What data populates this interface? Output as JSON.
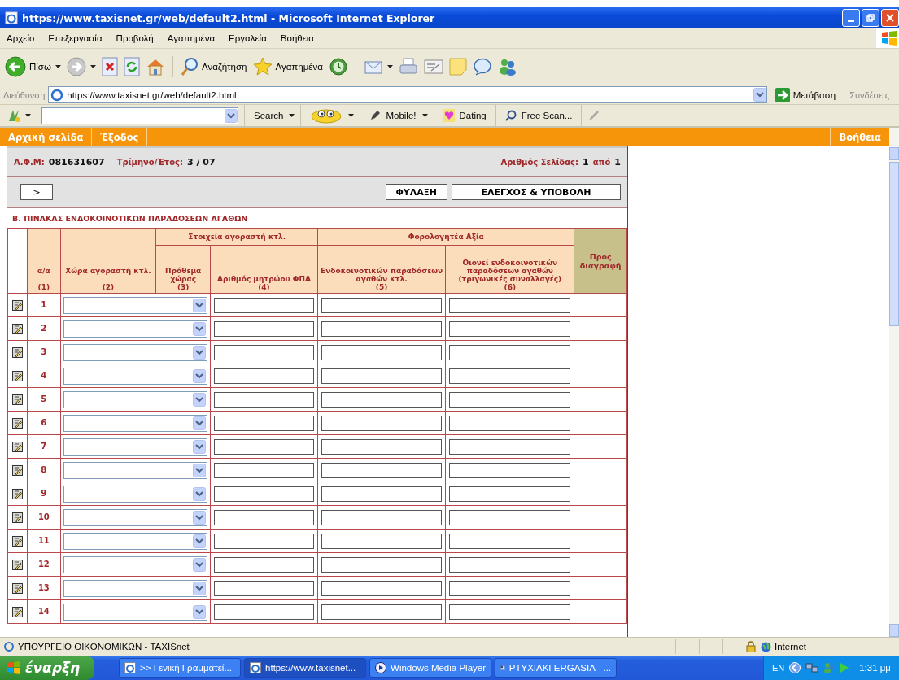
{
  "window": {
    "title": "https://www.taxisnet.gr/web/default2.html - Microsoft Internet Explorer"
  },
  "menu": [
    "Αρχείο",
    "Επεξεργασία",
    "Προβολή",
    "Αγαπημένα",
    "Εργαλεία",
    "Βοήθεια"
  ],
  "toolbar": [
    {
      "kind": "back",
      "label": "Πίσω"
    },
    {
      "kind": "forward"
    },
    {
      "kind": "stop"
    },
    {
      "kind": "refresh"
    },
    {
      "kind": "home"
    },
    {
      "kind": "search",
      "label": "Αναζήτηση"
    },
    {
      "kind": "favorites",
      "label": "Αγαπημένα"
    },
    {
      "kind": "history"
    },
    {
      "kind": "mail"
    },
    {
      "kind": "print"
    },
    {
      "kind": "edit"
    },
    {
      "kind": "note"
    },
    {
      "kind": "chat"
    },
    {
      "kind": "people"
    }
  ],
  "address": {
    "label": "Διεύθυνση",
    "value": "https://www.taxisnet.gr/web/default2.html",
    "go": "Μετάβαση",
    "links": "Συνδέσεις"
  },
  "links_bar": [
    {
      "kind": "menu",
      "label": "Search"
    },
    {
      "kind": "smiley"
    },
    {
      "kind": "menu",
      "label": "Mobile!"
    },
    {
      "kind": "link",
      "label": "Dating"
    },
    {
      "kind": "scan",
      "label": "Free Scan..."
    }
  ],
  "site_nav": {
    "items": [
      "Αρχική σελίδα",
      "Έξοδος"
    ],
    "help": "Βοήθεια"
  },
  "info": {
    "afm_label": "Α.Φ.Μ:",
    "afm": "081631607",
    "period_label": "Τρίμηνο/Έτος:",
    "period": "3 / 07",
    "page_label": "Αριθμός Σελίδας:",
    "page": "1",
    "of": "από",
    "pages": "1"
  },
  "buttons": {
    "next": ">",
    "save": "ΦΥΛΑΞΗ",
    "submit": "ΕΛΕΓΧΟΣ & ΥΠΟΒΟΛΗ"
  },
  "section_title": "Β. ΠΙΝΑΚΑΣ ΕΝΔΟΚΟΙΝΟΤΙΚΩΝ ΠΑΡΑΔΟΣΕΩΝ ΑΓΑΘΩΝ",
  "table": {
    "groups": [
      "Στοιχεία αγοραστή κτλ.",
      "Φορολογητέα Αξία"
    ],
    "columns": [
      {
        "title": "α/α",
        "num": "(1)"
      },
      {
        "title": "Χώρα αγοραστή κτλ.",
        "num": "(2)"
      },
      {
        "title": "Πρόθεμα χώρας",
        "num": "(3)"
      },
      {
        "title": "Αριθμός μητρώου ΦΠΑ",
        "num": "(4)"
      },
      {
        "title": "Ενδοκοινοτικών παραδόσεων αγαθών κτλ.",
        "num": "(5)"
      },
      {
        "title": "Οιονεί ενδοκοινοτικών παραδόσεων αγαθών (τριγωνικές συναλλαγές)",
        "num": "(6)"
      },
      {
        "title": "Προς διαγραφή"
      }
    ],
    "rows": [
      "1",
      "2",
      "3",
      "4",
      "5",
      "6",
      "7",
      "8",
      "9",
      "10",
      "11",
      "12",
      "13",
      "14"
    ]
  },
  "status_bar": {
    "text": "ΥΠΟΥΡΓΕΙΟ ΟΙΚΟΝΟΜΙΚΩΝ - TAXISnet",
    "zone": "Internet"
  },
  "taskbar": {
    "start": "έναρξη",
    "tasks": [
      {
        "label": ">> Γενική Γραμματεί...",
        "kind": "ie",
        "selected": false
      },
      {
        "label": "https://www.taxisnet...",
        "kind": "ie",
        "selected": true
      },
      {
        "label": "Windows Media Player",
        "kind": "media",
        "selected": false
      },
      {
        "label": "PTYXIAKI ERGASIA - ...",
        "kind": "word",
        "selected": false
      }
    ],
    "language": "EN",
    "time": "1:31 μμ"
  }
}
